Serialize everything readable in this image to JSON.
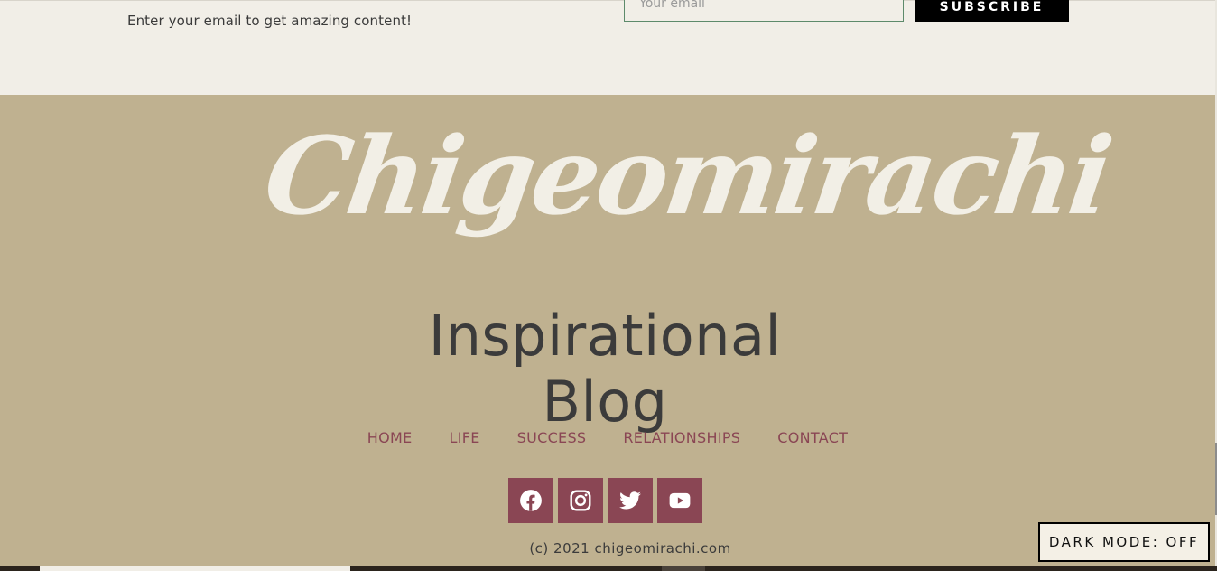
{
  "newsletter": {
    "tagline": "Enter your email to get amazing content!",
    "email_placeholder": "Your email",
    "subscribe_label": "SUBSCRIBE"
  },
  "footer": {
    "logo_text": "Chigeomirachi",
    "subtitle": "Inspirational Blog",
    "nav": [
      "HOME",
      "LIFE",
      "SUCCESS",
      "RELATIONSHIPS",
      "CONTACT"
    ],
    "socials": [
      {
        "name": "facebook-icon"
      },
      {
        "name": "instagram-icon"
      },
      {
        "name": "twitter-icon"
      },
      {
        "name": "youtube-icon"
      }
    ],
    "copyright": "(c) 2021 chigeomirachi.com"
  },
  "dark_mode": {
    "label": "DARK MODE: OFF"
  },
  "colors": {
    "footer_bg": "#bfb190",
    "accent": "#8a4654",
    "newsletter_bg": "#f1eee7"
  }
}
